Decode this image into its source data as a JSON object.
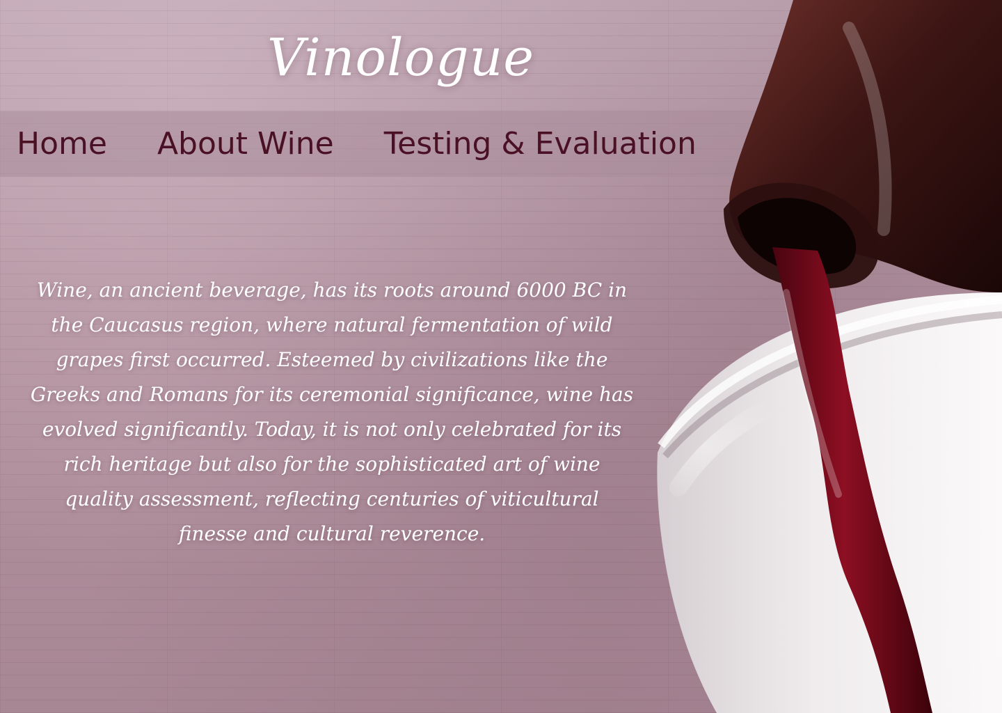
{
  "brand": {
    "name": "Vinologue"
  },
  "nav": {
    "items": [
      {
        "label": "Home"
      },
      {
        "label": "About Wine"
      },
      {
        "label": "Testing & Evaluation"
      }
    ]
  },
  "hero": {
    "text": "Wine, an ancient beverage, has its roots around 6000 BC in the Caucasus region, where natural fermentation of wild grapes first occurred. Esteemed by civilizations like the Greeks and Romans for its ceremonial significance, wine has evolved significantly. Today, it is not only celebrated for its rich heritage but also for the sophisticated art of wine quality assessment, reflecting centuries of viticultural finesse and cultural reverence."
  },
  "colors": {
    "page_bg": "#b79aa6",
    "nav_text": "#4a1024",
    "brand_text": "#ffffff",
    "wine": "#7a0f1f"
  },
  "images": {
    "wine_pour_photo": "wine-pour-photo"
  }
}
